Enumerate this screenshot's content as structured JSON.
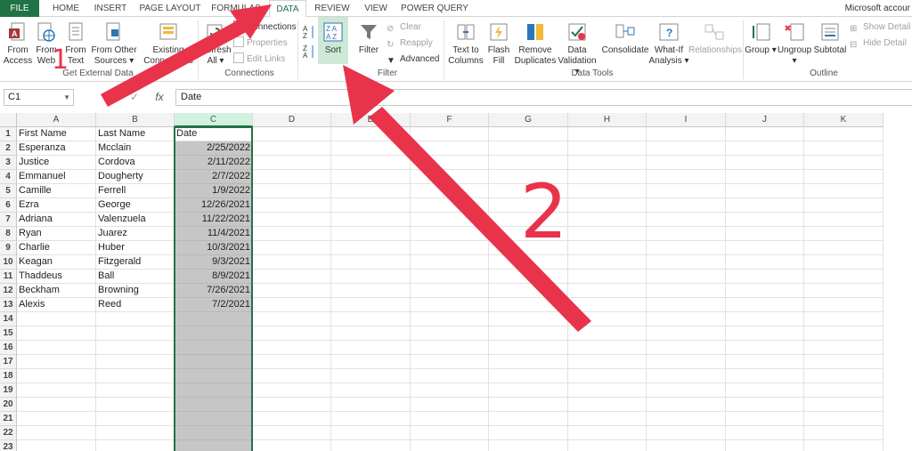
{
  "tabs": [
    {
      "label": "FILE",
      "active": false
    },
    {
      "label": "HOME",
      "active": false
    },
    {
      "label": "INSERT",
      "active": false
    },
    {
      "label": "PAGE LAYOUT",
      "active": false
    },
    {
      "label": "FORMULAS",
      "active": false
    },
    {
      "label": "DATA",
      "active": true
    },
    {
      "label": "REVIEW",
      "active": false
    },
    {
      "label": "VIEW",
      "active": false
    },
    {
      "label": "POWER QUERY",
      "active": false
    }
  ],
  "account": "Microsoft accour",
  "ribbon": {
    "from_access": [
      "From",
      "Access"
    ],
    "from_web": [
      "From",
      "Web"
    ],
    "from_text": [
      "From",
      "Text"
    ],
    "from_other": [
      "From Other",
      "Sources ▾"
    ],
    "existing": [
      "Existing",
      "Connections"
    ],
    "refresh": [
      "Refresh",
      "All ▾"
    ],
    "connections": "Connections",
    "properties": "Properties",
    "edit_links": "Edit Links",
    "sort": "Sort",
    "filter": "Filter",
    "clear": "Clear",
    "reapply": "Reapply",
    "advanced": "Advanced",
    "text_to_columns": [
      "Text to",
      "Columns"
    ],
    "flash_fill": [
      "Flash",
      "Fill"
    ],
    "remove_dup": [
      "Remove",
      "Duplicates"
    ],
    "data_validation": [
      "Data",
      "Validation ▾"
    ],
    "consolidate": "Consolidate",
    "what_if": [
      "What-If",
      "Analysis ▾"
    ],
    "relationships": "Relationships",
    "group": "Group ▾",
    "ungroup": "Ungroup ▾",
    "subtotal": "Subtotal",
    "show_detail": "Show Detail",
    "hide_detail": "Hide Detail",
    "groups": {
      "external": "Get External Data",
      "connections": "Connections",
      "sort_filter": "Filter",
      "data_tools": "Data Tools",
      "outline": "Outline"
    }
  },
  "namebox": "C1",
  "formula": "Date",
  "columns": [
    "A",
    "B",
    "C",
    "D",
    "E",
    "F",
    "G",
    "H",
    "I",
    "J",
    "K"
  ],
  "rows": [
    [
      "First Name",
      "Last Name",
      "Date"
    ],
    [
      "Esperanza",
      "Mcclain",
      "2/25/2022"
    ],
    [
      "Justice",
      "Cordova",
      "2/11/2022"
    ],
    [
      "Emmanuel",
      "Dougherty",
      "2/7/2022"
    ],
    [
      "Camille",
      "Ferrell",
      "1/9/2022"
    ],
    [
      "Ezra",
      "George",
      "12/26/2021"
    ],
    [
      "Adriana",
      "Valenzuela",
      "11/22/2021"
    ],
    [
      "Ryan",
      "Juarez",
      "11/4/2021"
    ],
    [
      "Charlie",
      "Huber",
      "10/3/2021"
    ],
    [
      "Keagan",
      "Fitzgerald",
      "9/3/2021"
    ],
    [
      "Thaddeus",
      "Ball",
      "8/9/2021"
    ],
    [
      "Beckham",
      "Browning",
      "7/26/2021"
    ],
    [
      "Alexis",
      "Reed",
      "7/2/2021"
    ]
  ],
  "row_count": 23,
  "annotations": [
    "1",
    "2"
  ],
  "colors": {
    "excel_green": "#217346",
    "arrow_red": "#e8334a",
    "selected_fill": "#c6c6c6"
  }
}
